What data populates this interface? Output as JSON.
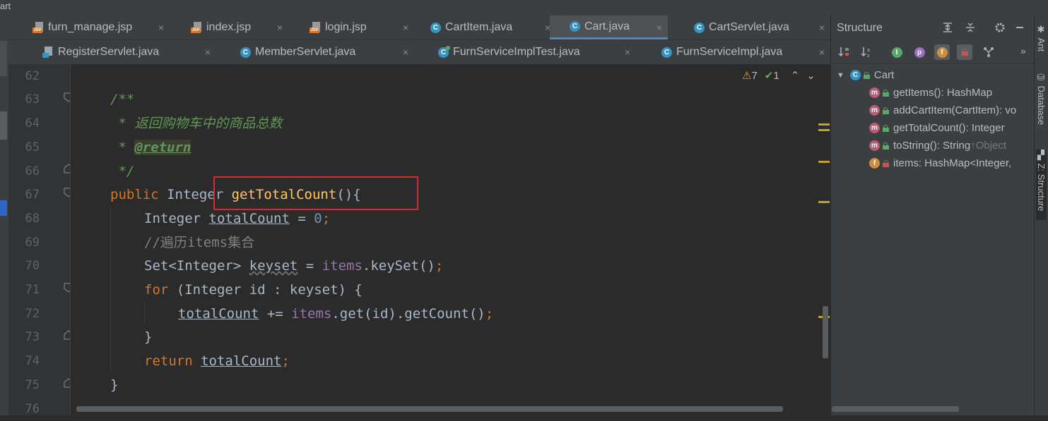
{
  "window": {
    "title_fragment": "art"
  },
  "tabs_row1": [
    {
      "label": "furn_manage.jsp",
      "icon": "jsp-file-icon"
    },
    {
      "label": "index.jsp",
      "icon": "jsp-file-icon"
    },
    {
      "label": "login.jsp",
      "icon": "jsp-file-icon"
    },
    {
      "label": "CartItem.java",
      "icon": "class-icon"
    },
    {
      "label": "Cart.java",
      "icon": "class-icon",
      "active": true
    },
    {
      "label": "CartServlet.java",
      "icon": "class-icon"
    }
  ],
  "tabs_row2": [
    {
      "label": "RegisterServlet.java",
      "icon": "java-file-icon"
    },
    {
      "label": "MemberServlet.java",
      "icon": "class-icon"
    },
    {
      "label": "FurnServiceImplTest.java",
      "icon": "test-class-icon"
    },
    {
      "label": "FurnServiceImpl.java",
      "icon": "class-icon"
    }
  ],
  "tab_close_glyph": "×",
  "inspection": {
    "warnings": "7",
    "weak_warnings": "1",
    "warning_icon": "⚠",
    "check_icon": "✔",
    "up": "⌃",
    "down": "⌄"
  },
  "line_numbers": [
    "62",
    "63",
    "64",
    "65",
    "66",
    "67",
    "68",
    "69",
    "70",
    "71",
    "72",
    "73",
    "74",
    "75",
    "76"
  ],
  "code": {
    "l63": "/**",
    "l64": " * 返回购物车中的商品总数",
    "l65_star": " * ",
    "l65_tag": "@return",
    "l66": " */",
    "l67_kw": "public",
    "l67_type": " Integer ",
    "l67_fn": "getTotalCount",
    "l67_rest": "(){",
    "l68_type": "Integer ",
    "l68_var": "totalCount",
    "l68_eq": " = ",
    "l68_num": "0",
    "l68_semi": ";",
    "l69": "//遍历items集合",
    "l70_type": "Set<Integer> ",
    "l70_var": "keyset",
    "l70_eq": " = ",
    "l70_field": "items",
    "l70_rest": ".keySet()",
    "l70_semi": ";",
    "l71_kw": "for",
    "l71_rest": " (Integer id : keyset) {",
    "l72_var": "totalCount",
    "l72_op": " += ",
    "l72_field": "items",
    "l72_rest": ".get(id).getCount()",
    "l72_semi": ";",
    "l73": "}",
    "l74_kw": "return ",
    "l74_var": "totalCount",
    "l74_semi": ";",
    "l75": "}"
  },
  "structure": {
    "title": "Structure",
    "root": "Cart",
    "items": [
      {
        "badge": "m",
        "label": "getItems(): HashMap",
        "access": "public"
      },
      {
        "badge": "m",
        "label": "addCartItem(CartItem): vo",
        "access": "public"
      },
      {
        "badge": "m",
        "label": "getTotalCount(): Integer",
        "access": "public"
      },
      {
        "badge": "m",
        "label": "toString(): String ",
        "inherit": "↑Object",
        "access": "public"
      },
      {
        "badge": "f",
        "label": "items: HashMap<Integer, ",
        "access": "private"
      }
    ],
    "toolbar": {
      "p_badge": "p",
      "f_badge": "f",
      "i_badge": "I"
    }
  },
  "side_tools": {
    "ant": "Ant",
    "database": "Database",
    "structure": "Z: Structure"
  },
  "colors": {
    "accent": "#4a88c7",
    "highlight": "#e0252b",
    "keyword": "#cc7832",
    "method": "#ffc66d",
    "field": "#9876aa",
    "doc": "#629755"
  }
}
